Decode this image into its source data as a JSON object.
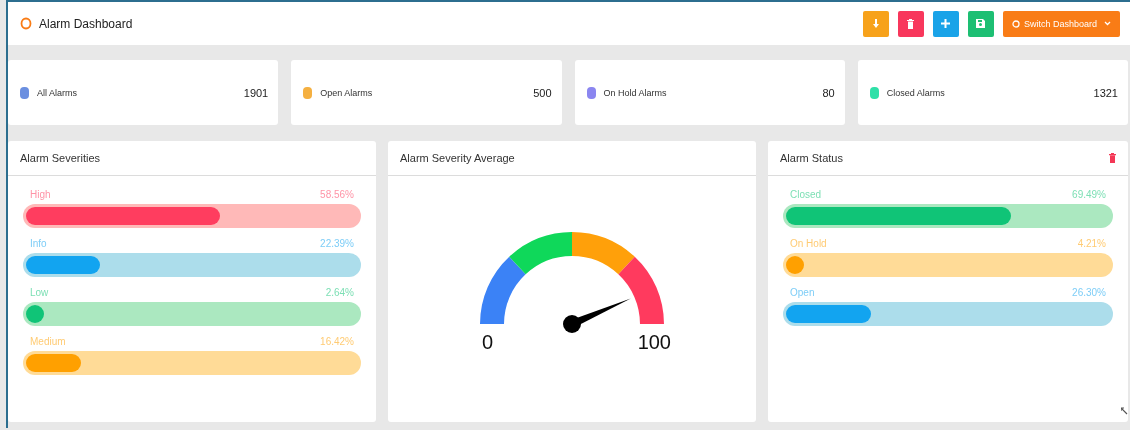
{
  "header": {
    "title": "Alarm Dashboard",
    "actions": [
      {
        "kind": "download",
        "color": "#f7a21b"
      },
      {
        "kind": "delete",
        "color": "#f8375c"
      },
      {
        "kind": "add",
        "color": "#1aa3e8"
      },
      {
        "kind": "save",
        "color": "#1dbf73"
      }
    ],
    "switch_button": {
      "label": "Switch Dashboard",
      "color": "#f97c16"
    }
  },
  "stats": [
    {
      "label": "All Alarms",
      "value": "1901",
      "color": "#6b8fe0"
    },
    {
      "label": "Open Alarms",
      "value": "500",
      "color": "#f5b041"
    },
    {
      "label": "On Hold Alarms",
      "value": "80",
      "color": "#8b86f0"
    },
    {
      "label": "Closed Alarms",
      "value": "1321",
      "color": "#2fe0a8"
    }
  ],
  "severities": {
    "title": "Alarm Severities",
    "items": [
      {
        "label": "High",
        "percent": "58.56%",
        "level": 0.5856,
        "color": "#ff3d5f"
      },
      {
        "label": "Info",
        "percent": "22.39%",
        "level": 0.2239,
        "color": "#12a4f0"
      },
      {
        "label": "Low",
        "percent": "2.64%",
        "level": 0.0264,
        "color": "#10c477"
      },
      {
        "label": "Medium",
        "percent": "16.42%",
        "level": 0.1642,
        "color": "#ffa000"
      }
    ]
  },
  "average": {
    "title": "Alarm Severity Average",
    "min_label": "0",
    "max_label": "100"
  },
  "status": {
    "title": "Alarm Status",
    "items": [
      {
        "label": "Closed",
        "percent": "69.49%",
        "level": 0.6949,
        "color": "#10c477"
      },
      {
        "label": "On Hold",
        "percent": "4.21%",
        "level": 0.0421,
        "color": "#ffa000"
      },
      {
        "label": "Open",
        "percent": "26.30%",
        "level": 0.263,
        "color": "#12a4f0"
      }
    ]
  }
}
